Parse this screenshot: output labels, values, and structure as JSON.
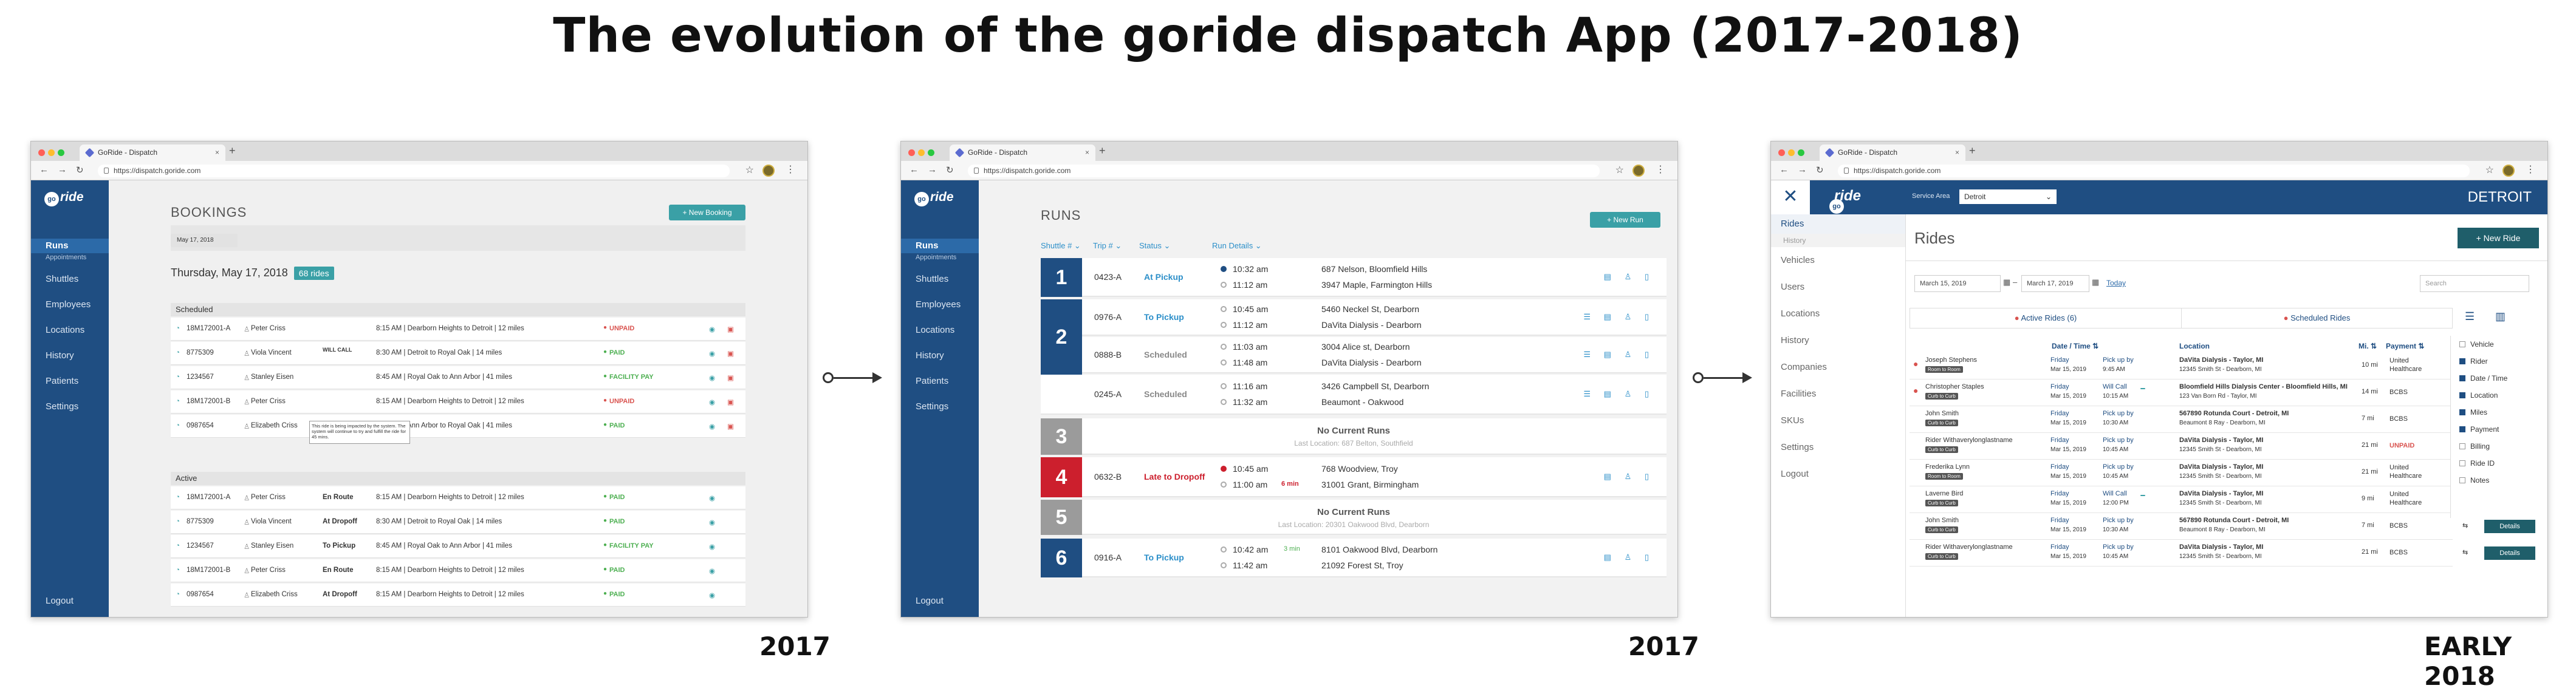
{
  "headline": "The evolution of the goride dispatch App (2017-2018)",
  "years": [
    "2017",
    "2017",
    "EARLY 2018"
  ],
  "browser": {
    "tab_title": "GoRide - Dispatch",
    "tab_close": "×",
    "new_tab": "+",
    "url": "https://dispatch.goride.com",
    "back": "←",
    "forward": "→",
    "reload": "↻",
    "star": "☆",
    "menu": "⋮"
  },
  "colors": {
    "brand": "#1f4e82",
    "teal": "#3aa0a6",
    "unpaid": "#d9534f",
    "paid": "#4caf50",
    "late": "#cc1f2d",
    "inactive": "#9b9b9b"
  },
  "logo": {
    "go": "go",
    "ride": "ride"
  },
  "shot1": {
    "sidebar": [
      "Runs",
      "Appointments",
      "Shuttles",
      "Employees",
      "Locations",
      "History",
      "Patients",
      "Settings"
    ],
    "logout": "Logout",
    "title": "BOOKINGS",
    "new_booking": "+ New Booking",
    "date_picker": "May 17, 2018",
    "date_heading": "Thursday, May 17, 2018",
    "ride_count": "68 rides",
    "scheduled_label": "Scheduled",
    "active_label": "Active",
    "tooltip": "This ride is being impacted by the system. The system will continue to try and fulfill the ride for 45 mins.",
    "scheduled": [
      {
        "id": "18M172001-A",
        "name": "Peter Criss",
        "note": "",
        "route": "8:15 AM | Dearborn Heights to Detroit | 12 miles",
        "status": "UNPAID"
      },
      {
        "id": "8775309",
        "name": "Viola Vincent",
        "note": "WILL CALL",
        "route": "8:30 AM | Detroit to Royal Oak | 14 miles",
        "status": "PAID"
      },
      {
        "id": "1234567",
        "name": "Stanley Eisen",
        "note": "",
        "route": "8:45 AM | Royal Oak to Ann Arbor | 41 miles",
        "status": "FACILITY PAY"
      },
      {
        "id": "18M172001-B",
        "name": "Peter Criss",
        "note": "",
        "route": "8:15 AM | Dearborn Heights to Detroit | 12 miles",
        "status": "UNPAID"
      },
      {
        "id": "0987654",
        "name": "Elizabeth Criss",
        "note": "",
        "route": "8:45 AM | Ann Arbor to Royal Oak | 41 miles",
        "status": "PAID"
      }
    ],
    "active": [
      {
        "id": "18M172001-A",
        "name": "Peter Criss",
        "state": "En Route",
        "route": "8:15 AM | Dearborn Heights to Detroit | 12 miles",
        "status": "PAID"
      },
      {
        "id": "8775309",
        "name": "Viola Vincent",
        "state": "At Dropoff",
        "route": "8:30 AM | Detroit to Royal Oak | 14 miles",
        "status": "PAID"
      },
      {
        "id": "1234567",
        "name": "Stanley Eisen",
        "state": "To Pickup",
        "route": "8:45 AM | Royal Oak to Ann Arbor | 41 miles",
        "status": "FACILITY PAY"
      },
      {
        "id": "18M172001-B",
        "name": "Peter Criss",
        "state": "En Route",
        "route": "8:15 AM | Dearborn Heights to Detroit | 12 miles",
        "status": "PAID"
      },
      {
        "id": "0987654",
        "name": "Elizabeth Criss",
        "state": "At Dropoff",
        "route": "8:15 AM | Dearborn Heights to Detroit | 12 miles",
        "status": "PAID"
      }
    ]
  },
  "shot2": {
    "sidebar": [
      "Runs",
      "Appointments",
      "Shuttles",
      "Employees",
      "Locations",
      "History",
      "Patients",
      "Settings"
    ],
    "logout": "Logout",
    "title": "RUNS",
    "new_run": "+ New Run",
    "filters": [
      "Shuttle # ⌄",
      "Trip # ⌄",
      "Status ⌄",
      "Run Details ⌄"
    ],
    "no_current": "No Current Runs",
    "runs": [
      {
        "shuttle": "1",
        "trip": "0423-A",
        "status": "At Pickup",
        "t1": "10:32 am",
        "t2": "11:12 am",
        "a1": "687 Nelson, Bloomfield Hills",
        "a2": "3947 Maple, Farmington Hills"
      },
      {
        "shuttle": "",
        "trip": "0976-A",
        "status": "To Pickup",
        "t1": "10:45 am",
        "t2": "11:12 am",
        "a1": "5460 Neckel St, Dearborn",
        "a2": "DaVita Dialysis - Dearborn"
      },
      {
        "shuttle": "2",
        "trip": "0888-B",
        "status": "Scheduled",
        "t1": "11:03 am",
        "t2": "11:48 am",
        "a1": "3004 Alice st, Dearborn",
        "a2": "DaVita Dialysis - Dearborn"
      },
      {
        "shuttle": "",
        "trip": "0245-A",
        "status": "Scheduled",
        "t1": "11:16 am",
        "t2": "11:32 am",
        "a1": "3426 Campbell St, Dearborn",
        "a2": "Beaumont - Oakwood"
      },
      {
        "shuttle": "3",
        "last": "Last Location: 687 Belton, Southfield"
      },
      {
        "shuttle": "4",
        "trip": "0632-B",
        "status": "Late to Dropoff",
        "t1": "10:45 am",
        "t2": "11:00 am",
        "late": "6 min",
        "a1": "768 Woodview, Troy",
        "a2": "31001 Grant, Birmingham"
      },
      {
        "shuttle": "5",
        "last": "Last Location: 20301 Oakwood Blvd, Dearborn"
      },
      {
        "shuttle": "6",
        "trip": "0916-A",
        "status": "To Pickup",
        "t1": "10:42 am",
        "t2": "11:42 am",
        "early": "3 min",
        "a1": "8101 Oakwood Blvd, Dearborn",
        "a2": "21092 Forest St, Troy"
      }
    ]
  },
  "shot3": {
    "service_area_label": "Service Area",
    "service_area": "Detroit",
    "city": "DETROIT",
    "sidebar": [
      "Rides",
      "History",
      "Vehicles",
      "Users",
      "Locations",
      "History",
      "Companies",
      "Facilities",
      "SKUs",
      "Settings",
      "Logout"
    ],
    "title": "Rides",
    "new_ride": "+ New Ride",
    "date_from": "March 15, 2019",
    "date_to": "March 17, 2019",
    "today": "Today",
    "search": "Search",
    "tab_active": "Active Rides (6)",
    "tab_scheduled": "Scheduled Rides",
    "headers": [
      "Date / Time ⇅",
      "Location",
      "Mi. ⇅",
      "Payment ⇅"
    ],
    "columns": [
      "Vehicle",
      "Rider",
      "Date / Time",
      "Location",
      "Miles",
      "Payment",
      "Billing",
      "Ride ID",
      "Notes"
    ],
    "details": "Details",
    "rides": [
      {
        "name": "Joseph Stephens",
        "tags": [
          "Ambulatory",
          "Room to Room"
        ],
        "day": "Friday",
        "date": "Mar 15, 2019",
        "pick": "Pick up by",
        "ptime": "9:45 AM",
        "loc1": "DaVita Dialysis - Taylor, MI",
        "loc2": "12345 Smith St - Dearborn, MI",
        "mi": "10 mi",
        "pay": "United Healthcare"
      },
      {
        "name": "Christopher Staples",
        "tags": [
          "Wheelchair",
          "Curb to Curb"
        ],
        "day": "Friday",
        "date": "Mar 15, 2019",
        "pick": "Will Call",
        "ptime": "10:15 AM",
        "loc1": "Bloomfield Hills Dialysis Center - Bloomfield Hills, MI",
        "loc2": "123 Van Born Rd - Taylor, MI",
        "mi": "14 mi",
        "pay": "BCBS"
      },
      {
        "name": "John Smith",
        "tags": [
          "Ambulatory",
          "Curb to Curb"
        ],
        "day": "Friday",
        "date": "Mar 15, 2019",
        "pick": "Pick up by",
        "ptime": "10:30 AM",
        "loc1": "567890 Rotunda Court - Detroit, MI",
        "loc2": "Beaumont 8 Ray - Dearborn, MI",
        "mi": "7 mi",
        "pay": "BCBS"
      },
      {
        "name": "Rider Withaverylonglastname",
        "tags": [
          "Wheelchair",
          "Curb to Curb"
        ],
        "day": "Friday",
        "date": "Mar 15, 2019",
        "pick": "Pick up by",
        "ptime": "10:45 AM",
        "loc1": "DaVita Dialysis - Taylor, MI",
        "loc2": "12345 Smith St - Dearborn, MI",
        "mi": "21 mi",
        "pay": "UNPAID"
      },
      {
        "name": "Frederika Lynn",
        "tags": [
          "Ambulatory",
          "Room to Room"
        ],
        "day": "Friday",
        "date": "Mar 15, 2019",
        "pick": "Pick up by",
        "ptime": "10:45 AM",
        "loc1": "DaVita Dialysis - Taylor, MI",
        "loc2": "12345 Smith St - Dearborn, MI",
        "mi": "21 mi",
        "pay": "United Healthcare"
      },
      {
        "name": "Laverne Bird",
        "tags": [
          "Ambulatory",
          "Curb to Curb"
        ],
        "day": "Friday",
        "date": "Mar 15, 2019",
        "pick": "Will Call",
        "ptime": "12:00 PM",
        "loc1": "DaVita Dialysis - Taylor, MI",
        "loc2": "12345 Smith St - Dearborn, MI",
        "mi": "9 mi",
        "pay": "United Healthcare"
      },
      {
        "name": "John Smith",
        "tags": [
          "Ambulatory",
          "Curb to Curb"
        ],
        "day": "Friday",
        "date": "Mar 15, 2019",
        "pick": "Pick up by",
        "ptime": "10:30 AM",
        "loc1": "567890 Rotunda Court - Detroit, MI",
        "loc2": "Beaumont 8 Ray - Dearborn, MI",
        "mi": "7 mi",
        "pay": "BCBS"
      },
      {
        "name": "Rider Withaverylonglastname",
        "tags": [
          "Wheelchair",
          "Curb to Curb"
        ],
        "day": "Friday",
        "date": "Mar 15, 2019",
        "pick": "Pick up by",
        "ptime": "10:45 AM",
        "loc1": "DaVita Dialysis - Taylor, MI",
        "loc2": "12345 Smith St - Dearborn, MI",
        "mi": "21 mi",
        "pay": "BCBS"
      }
    ]
  }
}
